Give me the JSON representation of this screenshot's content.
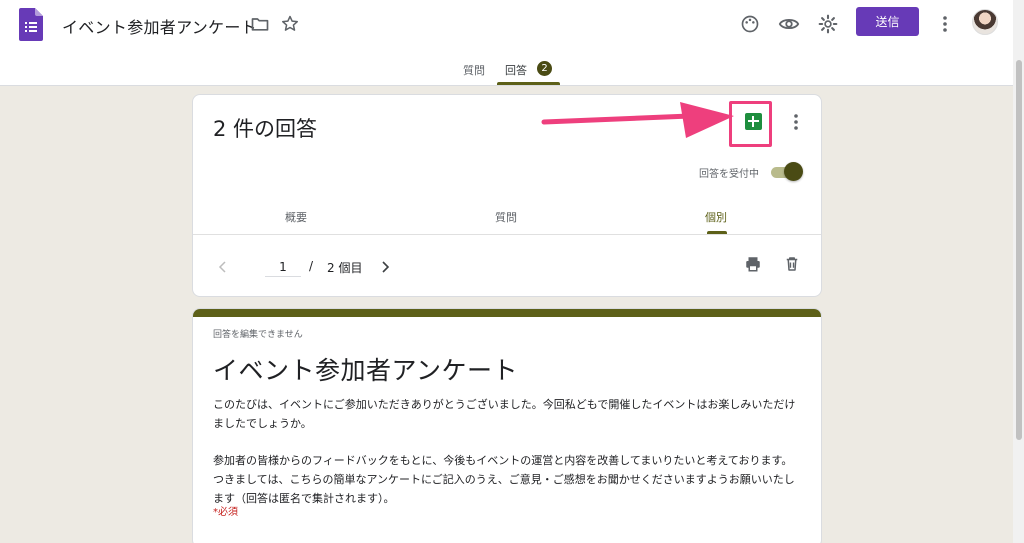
{
  "app": {
    "title": "イベント参加者アンケート",
    "send_label": "送信",
    "accent_color": "#673ab7",
    "theme_color": "#5d6018"
  },
  "tabs": [
    {
      "label": "質問",
      "active": false
    },
    {
      "label": "回答",
      "active": true,
      "badge": "2"
    }
  ],
  "responses": {
    "count_title": "2 件の回答",
    "accepting_label": "回答を受付中",
    "accepting": true,
    "sub_tabs": [
      {
        "label": "概要",
        "active": false
      },
      {
        "label": "質問",
        "active": false
      },
      {
        "label": "個別",
        "active": true
      }
    ],
    "pager": {
      "current": "1",
      "slash": "/",
      "total": "2 個目"
    }
  },
  "form": {
    "noedit_label": "回答を編集できません",
    "title": "イベント参加者アンケート",
    "desc1": "このたびは、イベントにご参加いただきありがとうございました。今回私どもで開催したイベントはお楽しみいただけましたでしょうか。",
    "desc2": "参加者の皆様からのフィードバックをもとに、今後もイベントの運営と内容を改善してまいりたいと考えております。つきましては、こちらの簡単なアンケートにご記入のうえ、ご意見・ご感想をお聞かせくださいますようお願いいたします（回答は匿名で集計されます）。",
    "required_label": "*必須"
  },
  "icons": [
    "forms-logo-icon",
    "folder-icon",
    "star-icon",
    "palette-icon",
    "eye-icon",
    "gear-icon",
    "more-vert-icon",
    "sheets-icon",
    "chevron-left-icon",
    "chevron-right-icon",
    "print-icon",
    "trash-icon"
  ]
}
